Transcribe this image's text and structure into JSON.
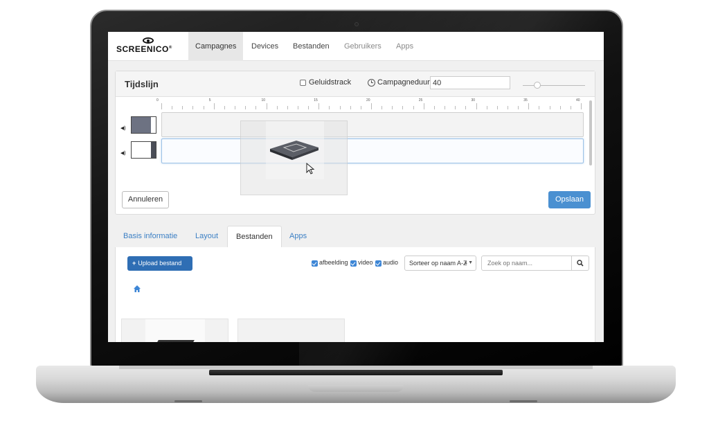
{
  "app": {
    "brand": "SCREENICO",
    "brand_mark": "®"
  },
  "nav": {
    "items": [
      {
        "label": "Campagnes",
        "state": "active"
      },
      {
        "label": "Devices",
        "state": "normal"
      },
      {
        "label": "Bestanden",
        "state": "normal"
      },
      {
        "label": "Gebruikers",
        "state": "muted"
      },
      {
        "label": "Apps",
        "state": "muted"
      }
    ]
  },
  "timeline": {
    "title": "Tijdslijn",
    "sound_track_label": "Geluidstrack",
    "sound_track_checked": false,
    "duration_label": "Campagneduur",
    "duration_value": "40",
    "ruler_labels": [
      "0",
      "5",
      "10",
      "15",
      "20",
      "25",
      "30",
      "35",
      "40"
    ],
    "cancel_label": "Annuleren",
    "save_label": "Opslaan"
  },
  "tabs": {
    "items": [
      {
        "label": "Basis informatie",
        "active": false
      },
      {
        "label": "Layout",
        "active": false
      },
      {
        "label": "Bestanden",
        "active": true
      },
      {
        "label": "Apps",
        "active": false
      }
    ]
  },
  "files": {
    "upload_label": "Upload bestand",
    "filters": [
      {
        "label": "afbeelding",
        "checked": true
      },
      {
        "label": "video",
        "checked": true
      },
      {
        "label": "audio",
        "checked": true
      }
    ],
    "sort_value": "Sorteer op naam A-Z",
    "search_placeholder": "Zoek op naam..."
  },
  "colors": {
    "primary": "#4a90d1",
    "upload": "#2f6eb4",
    "link": "#3b7fc4"
  },
  "icons": {
    "clock": "clock-icon",
    "speaker": "speaker-icon",
    "search": "search-icon",
    "home": "home-icon",
    "cursor": "cursor-arrow-icon"
  }
}
